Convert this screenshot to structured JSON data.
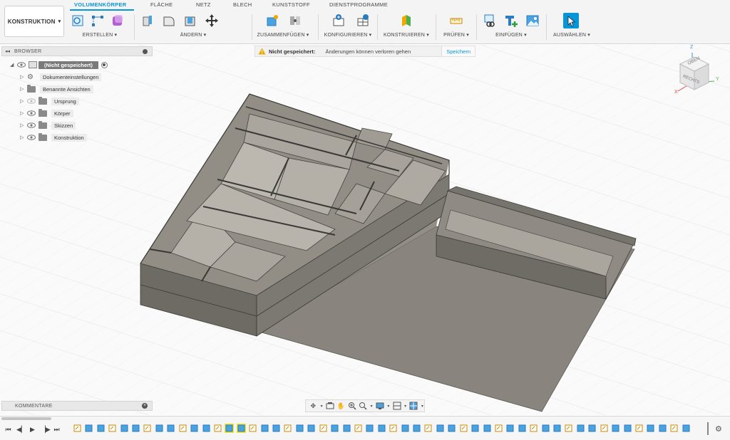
{
  "toolbar": {
    "workspace": "KONSTRUKTION",
    "tabs": [
      "VOLUMENKÖRPER",
      "FLÄCHE",
      "NETZ",
      "BLECH",
      "KUNSTSTOFF",
      "DIENSTPROGRAMME"
    ],
    "active_tab": "VOLUMENKÖRPER",
    "groups": [
      {
        "label": "ERSTELLEN ▾",
        "icons": [
          "new-sketch-icon",
          "sketch-dims-icon",
          "form-icon"
        ]
      },
      {
        "label": "ÄNDERN ▾",
        "icons": [
          "extrude-icon",
          "fillet-icon",
          "shell-icon",
          "move-icon"
        ]
      },
      {
        "label": "ZUSAMMENFÜGEN ▾",
        "icons": [
          "new-component-icon",
          "joint-icon"
        ]
      },
      {
        "label": "KONFIGURIEREN ▾",
        "icons": [
          "parameters-icon",
          "configure-table-icon"
        ]
      },
      {
        "label": "KONSTRUIEREN ▾",
        "icons": [
          "plane-icon"
        ]
      },
      {
        "label": "PRÜFEN ▾",
        "icons": [
          "measure-icon"
        ]
      },
      {
        "label": "EINFÜGEN ▾",
        "icons": [
          "insert-link-icon",
          "decal-icon",
          "canvas-icon"
        ]
      },
      {
        "label": "AUSWÄHLEN ▾",
        "icons": [
          "select-icon"
        ]
      }
    ]
  },
  "browser": {
    "title": "BROWSER",
    "items": [
      {
        "label": "(Nicht gespeichert)",
        "type": "root"
      },
      {
        "label": "Dokumenteinstellungen",
        "type": "settings"
      },
      {
        "label": "Benannte Ansichten",
        "type": "folder"
      },
      {
        "label": "Ursprung",
        "type": "folder-eye-hidden"
      },
      {
        "label": "Körper",
        "type": "folder-eye"
      },
      {
        "label": "Skizzen",
        "type": "folder-eye"
      },
      {
        "label": "Konstruktion",
        "type": "folder-eye"
      }
    ]
  },
  "warning": {
    "title": "Nicht gespeichert:",
    "message": "Änderungen können verloren gehen",
    "action": "Speichern"
  },
  "viewcube": {
    "top": "OBEN",
    "right": "RECHTS",
    "axes": [
      "Z",
      "Y",
      "X"
    ]
  },
  "comments": {
    "title": "KOMMENTARE"
  },
  "colors": {
    "accent": "#0696d7",
    "model": "#7a776f",
    "model_dark": "#4a4844",
    "warning": "#f0a800",
    "timeline_highlight": "#f5e61d"
  },
  "timeline": {
    "controls": [
      "skip-start-icon",
      "step-back-icon",
      "play-icon",
      "step-forward-icon",
      "skip-end-icon"
    ],
    "item_count": 53,
    "highlighted_items": [
      13,
      14
    ]
  }
}
